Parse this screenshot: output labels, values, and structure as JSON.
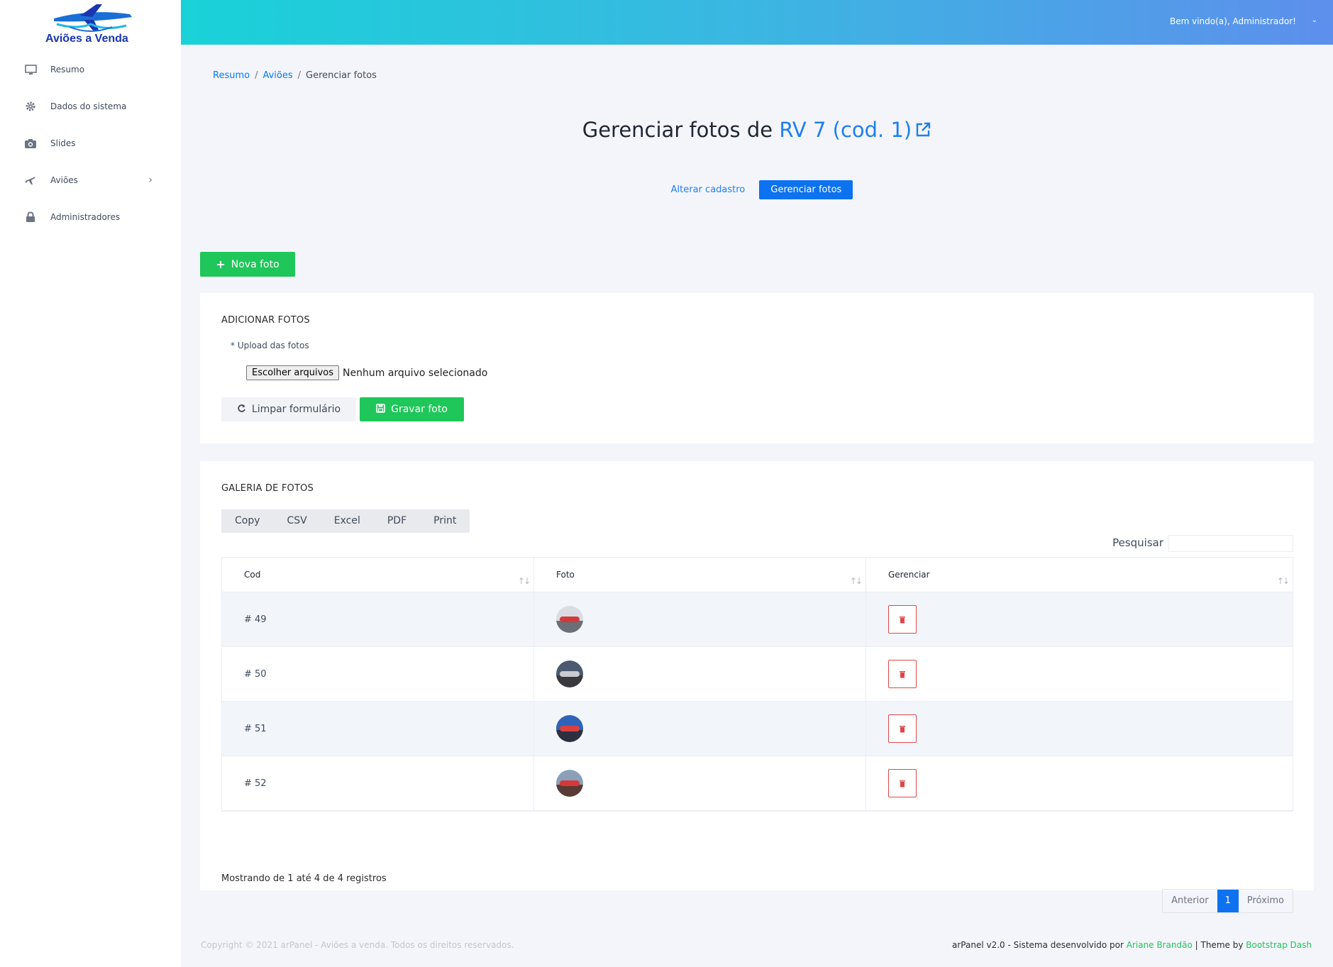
{
  "brand": {
    "name": "Aviões a Venda"
  },
  "sidebar": {
    "items": [
      {
        "label": "Resumo",
        "icon": "monitor-icon"
      },
      {
        "label": "Dados do sistema",
        "icon": "gear-icon"
      },
      {
        "label": "Slides",
        "icon": "camera-icon"
      },
      {
        "label": "Aviões",
        "icon": "plane-icon",
        "has_submenu": true
      },
      {
        "label": "Administradores",
        "icon": "lock-icon"
      }
    ]
  },
  "topbar": {
    "welcome": "Bem vindo(a), Administrador!"
  },
  "breadcrumb": {
    "items": [
      "Resumo",
      "Aviões",
      "Gerenciar fotos"
    ]
  },
  "page": {
    "title_prefix": "Gerenciar fotos de",
    "title_highlight": "RV 7 (cod. 1)",
    "tab_edit": "Alterar cadastro",
    "tab_photos": "Gerenciar fotos",
    "new_photo": "Nova foto"
  },
  "upload_card": {
    "title": "ADICIONAR FOTOS",
    "upload_label": "* Upload das fotos",
    "file_button": "Escolher arquivos",
    "file_status": "Nenhum arquivo selecionado",
    "clear_button": "Limpar formulário",
    "save_button": "Gravar foto"
  },
  "gallery": {
    "title": "GALERIA DE FOTOS",
    "export_buttons": [
      "Copy",
      "CSV",
      "Excel",
      "PDF",
      "Print"
    ],
    "search_label": "Pesquisar",
    "columns": [
      "Cod",
      "Foto",
      "Gerenciar"
    ],
    "rows": [
      {
        "cod": "# 49"
      },
      {
        "cod": "# 50"
      },
      {
        "cod": "# 51"
      },
      {
        "cod": "# 52"
      }
    ],
    "info": "Mostrando de 1 até 4 de 4 registros",
    "pager": {
      "prev": "Anterior",
      "current": "1",
      "next": "Próximo"
    }
  },
  "footer": {
    "copyright": "Copyright © 2021 arPanel - Aviões a venda. Todos os direitos reservados.",
    "credit_prefix": "arPanel v2.0 - Sistema desenvolvido por",
    "author": "Ariane Brandão",
    "theme_prefix": "| Theme by",
    "theme": "Bootstrap Dash"
  },
  "colors": {
    "accent": "#0d72f0",
    "success": "#1fc659",
    "danger": "#e04848"
  }
}
